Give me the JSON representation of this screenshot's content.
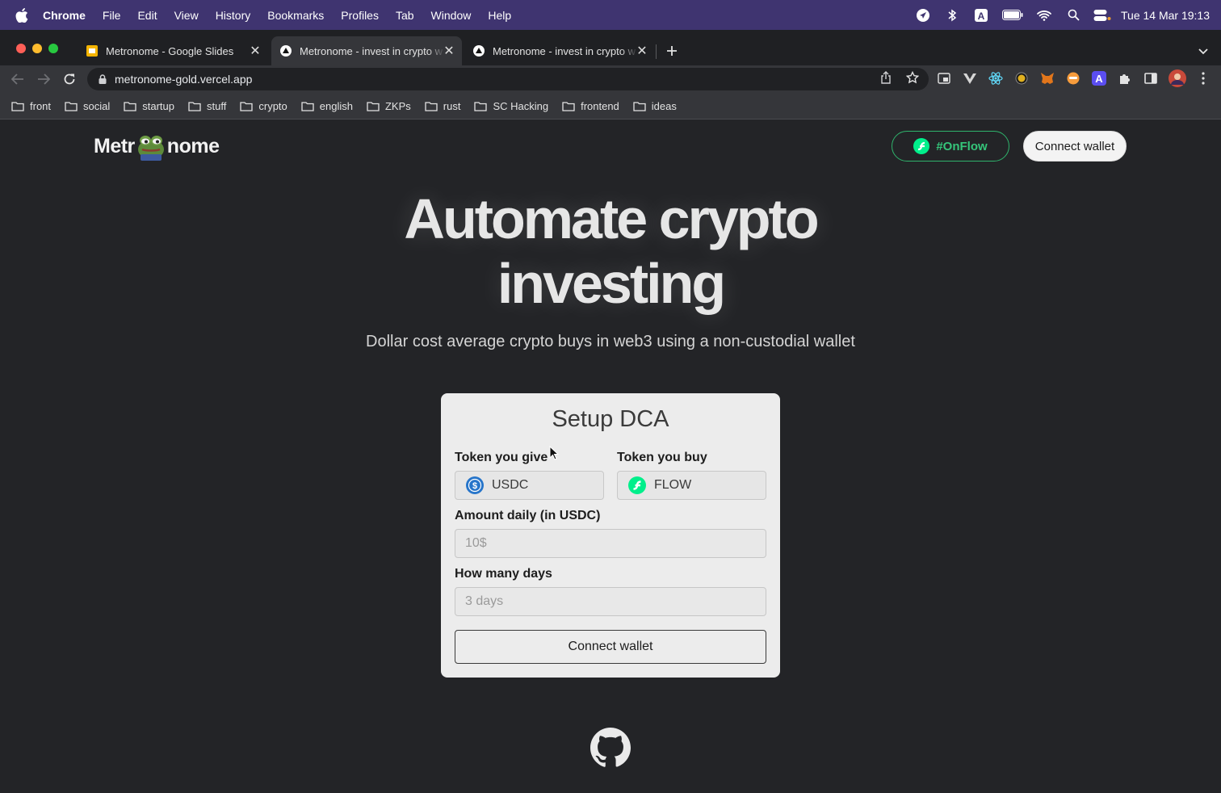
{
  "menubar": {
    "app_name": "Chrome",
    "items": [
      "File",
      "Edit",
      "View",
      "History",
      "Bookmarks",
      "Profiles",
      "Tab",
      "Window",
      "Help"
    ],
    "clock": "Tue 14 Mar  19:13"
  },
  "tabs": [
    {
      "title": "Metronome - Google Slides",
      "icon": "slides-icon",
      "active": false
    },
    {
      "title": "Metronome - invest in crypto w",
      "icon": "vercel-icon",
      "active": true
    },
    {
      "title": "Metronome - invest in crypto w",
      "icon": "vercel-icon",
      "active": false
    }
  ],
  "toolbar": {
    "url": "metronome-gold.vercel.app"
  },
  "bookmarks": [
    "front",
    "social",
    "startup",
    "stuff",
    "crypto",
    "english",
    "ZKPs",
    "rust",
    "SC Hacking",
    "frontend",
    "ideas"
  ],
  "page": {
    "logo_left": "Metr",
    "logo_right": "nome",
    "onflow_label": "#OnFlow",
    "connect_label": "Connect wallet",
    "hero_line1": "Automate crypto",
    "hero_line2": "investing",
    "subtitle": "Dollar cost average crypto buys in web3 using a non-custodial wallet"
  },
  "card": {
    "title": "Setup DCA",
    "give_label": "Token you give",
    "give_token": "USDC",
    "buy_label": "Token you buy",
    "buy_token": "FLOW",
    "amount_label": "Amount daily (in USDC)",
    "amount_placeholder": "10$",
    "days_label": "How many days",
    "days_placeholder": "3 days",
    "connect_label": "Connect wallet"
  },
  "colors": {
    "menubar_bg": "#3f3470",
    "page_bg": "#232427",
    "flow_green": "#35c57a",
    "usdc_blue": "#2775ca"
  }
}
